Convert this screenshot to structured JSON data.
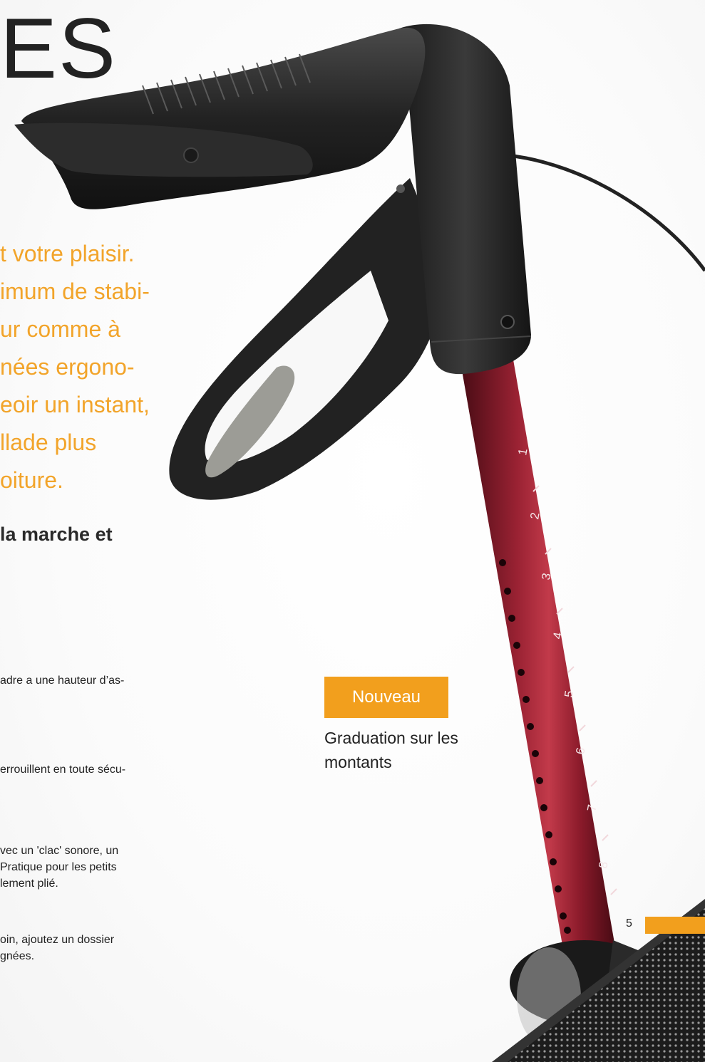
{
  "heading": {
    "title": "ES"
  },
  "intro": {
    "lines": [
      "t votre plaisir.",
      "imum de stabi-",
      "ur comme à",
      "nées ergono-",
      "eoir un instant,",
      "llade plus",
      "oiture."
    ]
  },
  "subheading": {
    "text": "la marche et"
  },
  "paragraphs": [
    {
      "lines": [
        "adre a une hauteur d’as-"
      ]
    },
    {
      "lines": [
        "errouillent en toute sécu-"
      ]
    },
    {
      "lines": [
        "vec un 'clac' sonore, un",
        "Pratique pour les petits",
        "lement plié."
      ]
    },
    {
      "lines": [
        "oin, ajoutez un dossier",
        "gnées."
      ]
    }
  ],
  "badge": {
    "label": "Nouveau"
  },
  "caption": {
    "line1": "Graduation sur les",
    "line2": "montants"
  },
  "page": {
    "number": "5"
  },
  "graduations": [
    "1",
    "2",
    "3",
    "4",
    "5",
    "6",
    "7",
    "8"
  ],
  "colors": {
    "accent": "#f29f1d",
    "tube": "#8e1c2c",
    "grip": "#2a2a2a"
  }
}
